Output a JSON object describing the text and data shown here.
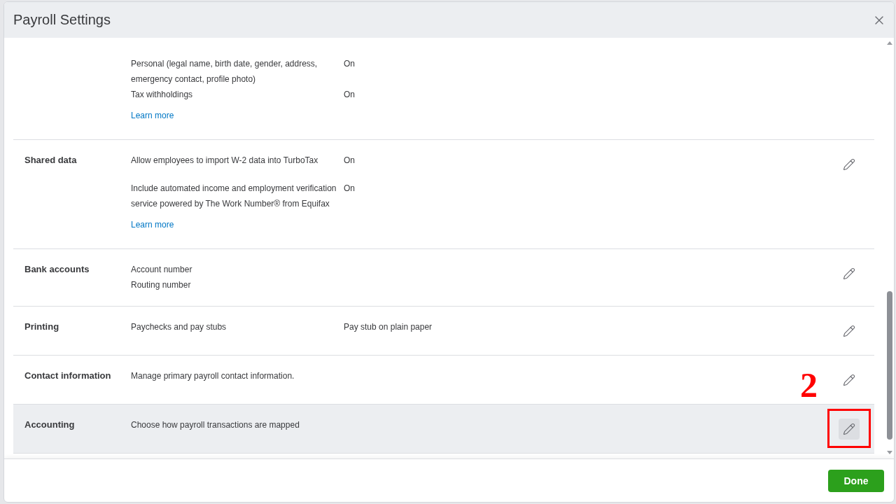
{
  "window": {
    "title": "Payroll Settings"
  },
  "sections": [
    {
      "groups": [
        {
          "items": [
            {
              "text": "Personal (legal name, birth date, gender, address, emergency contact, profile photo)",
              "value": "On"
            },
            {
              "text": "Tax withholdings",
              "value": "On"
            }
          ]
        }
      ],
      "link": "Learn more",
      "editable": false,
      "highlighted": false
    },
    {
      "label": "Shared data",
      "groups": [
        {
          "items": [
            {
              "text": "Allow employees to import W-2 data into TurboTax",
              "value": "On"
            }
          ]
        },
        {
          "items": [
            {
              "text": "Include automated income and employment verification service powered by The Work Number® from Equifax",
              "value": "On"
            }
          ]
        }
      ],
      "link": "Learn more",
      "editable": true,
      "highlighted": false
    },
    {
      "label": "Bank accounts",
      "groups": [
        {
          "items": [
            {
              "text": "Account number"
            },
            {
              "text": "Routing number"
            }
          ]
        }
      ],
      "editable": true,
      "highlighted": false
    },
    {
      "label": "Printing",
      "groups": [
        {
          "items": [
            {
              "text": "Paychecks and pay stubs",
              "value": "Pay stub on plain paper"
            }
          ]
        }
      ],
      "editable": true,
      "highlighted": false
    },
    {
      "label": "Contact information",
      "groups": [
        {
          "items": [
            {
              "text": "Manage primary payroll contact information."
            }
          ]
        }
      ],
      "editable": true,
      "highlighted": false
    },
    {
      "label": "Accounting",
      "groups": [
        {
          "items": [
            {
              "text": "Choose how payroll transactions are mapped"
            }
          ]
        }
      ],
      "editable": true,
      "highlighted": true,
      "annotation": {
        "label": "2"
      }
    }
  ],
  "footer": {
    "buttons": [
      "Done"
    ]
  }
}
